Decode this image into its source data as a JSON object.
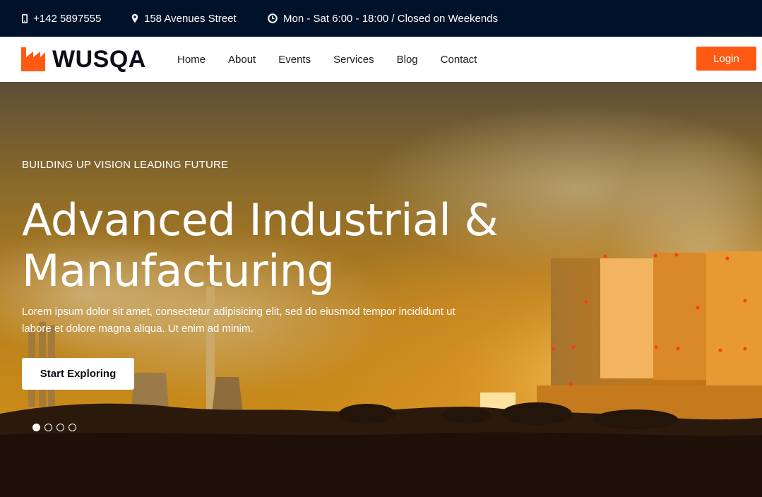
{
  "topbar": {
    "phone": "+142 5897555",
    "address": "158 Avenues Street",
    "hours": "Mon - Sat 6:00 - 18:00 / Closed on Weekends",
    "icons": [
      "phone-icon",
      "location-pin-icon",
      "clock-icon"
    ]
  },
  "brand": {
    "name": "WUSQA",
    "accent": "#ff5a14",
    "dark": "#001229"
  },
  "nav": {
    "items": [
      "Home",
      "About",
      "Events",
      "Services",
      "Blog",
      "Contact"
    ],
    "login_label": "Login"
  },
  "hero": {
    "eyebrow": "BUILDING UP VISION LEADING FUTURE",
    "headline_line1": "Advanced Industrial &",
    "headline_line2": "Manufacturing",
    "body": "Lorem ipsum dolor sit amet, consectetur adipisicing elit, sed do eiusmod tempor incididunt ut labore et dolore magna aliqua. Ut enim ad minim.",
    "cta_label": "Start Exploring",
    "slides_total": 4,
    "active_slide": 1
  }
}
